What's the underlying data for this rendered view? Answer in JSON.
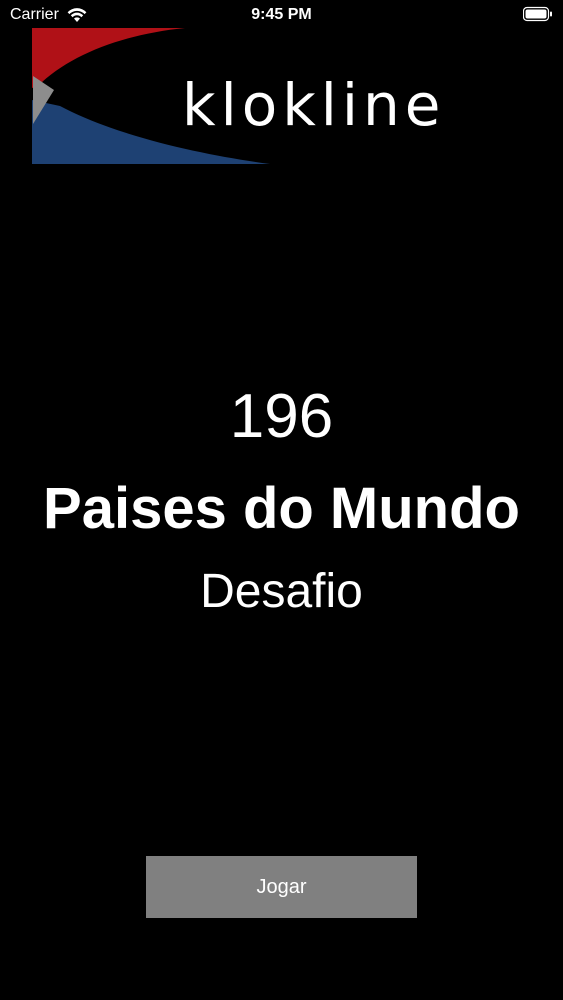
{
  "status_bar": {
    "carrier": "Carrier",
    "time": "9:45 PM",
    "icons": [
      "wifi-icon",
      "battery-icon"
    ]
  },
  "logo": {
    "wordmark": "klokline",
    "colors": {
      "red": "#b01117",
      "blue": "#1e4173",
      "grey": "#8d8d8d"
    }
  },
  "main": {
    "count": "196",
    "title": "Paises do Mundo",
    "subtitle": "Desafio"
  },
  "actions": {
    "play_label": "Jogar"
  },
  "colors": {
    "background": "#000000",
    "text": "#ffffff",
    "button": "#808080"
  }
}
